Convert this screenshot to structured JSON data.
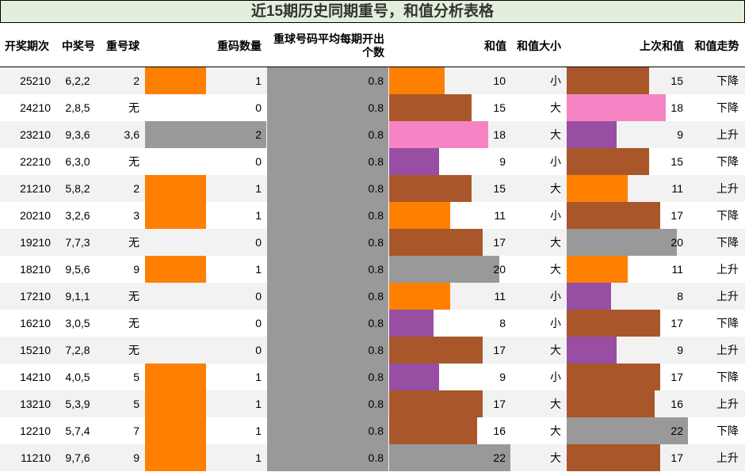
{
  "title": "近15期历史同期重号，和值分析表格",
  "headers": {
    "period": "开奖期次",
    "numbers": "中奖号",
    "repeat_ball": "重号球",
    "repeat_count": "重码数量",
    "avg_repeat": "重球号码平均每期开出个数",
    "sum": "和值",
    "sum_size": "和值大小",
    "prev_sum": "上次和值",
    "trend": "和值走势"
  },
  "colors": {
    "orange": "#ff7f00",
    "brown": "#a9572a",
    "pink": "#f683c3",
    "purple": "#984ea3",
    "gray": "#999999",
    "title_bg": "#e2efda",
    "row_shade": "#f2f2f2"
  },
  "chart_data": {
    "type": "table",
    "columns": [
      "开奖期次",
      "中奖号",
      "重号球",
      "重码数量",
      "重球号码平均每期开出个数",
      "和值",
      "和值大小",
      "上次和值",
      "和值走势"
    ],
    "rows": [
      {
        "period": "25210",
        "numbers": "6,2,2",
        "repeat_ball": "2",
        "repeat_count": 1,
        "avg_repeat": "0.8",
        "sum": 10,
        "size": "小",
        "prev_sum": 15,
        "trend": "下降"
      },
      {
        "period": "24210",
        "numbers": "2,8,5",
        "repeat_ball": "无",
        "repeat_count": 0,
        "avg_repeat": "0.8",
        "sum": 15,
        "size": "大",
        "prev_sum": 18,
        "trend": "下降"
      },
      {
        "period": "23210",
        "numbers": "9,3,6",
        "repeat_ball": "3,6",
        "repeat_count": 2,
        "avg_repeat": "0.8",
        "sum": 18,
        "size": "大",
        "prev_sum": 9,
        "trend": "上升"
      },
      {
        "period": "22210",
        "numbers": "6,3,0",
        "repeat_ball": "无",
        "repeat_count": 0,
        "avg_repeat": "0.8",
        "sum": 9,
        "size": "小",
        "prev_sum": 15,
        "trend": "下降"
      },
      {
        "period": "21210",
        "numbers": "5,8,2",
        "repeat_ball": "2",
        "repeat_count": 1,
        "avg_repeat": "0.8",
        "sum": 15,
        "size": "大",
        "prev_sum": 11,
        "trend": "上升"
      },
      {
        "period": "20210",
        "numbers": "3,2,6",
        "repeat_ball": "3",
        "repeat_count": 1,
        "avg_repeat": "0.8",
        "sum": 11,
        "size": "小",
        "prev_sum": 17,
        "trend": "下降"
      },
      {
        "period": "19210",
        "numbers": "7,7,3",
        "repeat_ball": "无",
        "repeat_count": 0,
        "avg_repeat": "0.8",
        "sum": 17,
        "size": "大",
        "prev_sum": 20,
        "trend": "下降"
      },
      {
        "period": "18210",
        "numbers": "9,5,6",
        "repeat_ball": "9",
        "repeat_count": 1,
        "avg_repeat": "0.8",
        "sum": 20,
        "size": "大",
        "prev_sum": 11,
        "trend": "上升"
      },
      {
        "period": "17210",
        "numbers": "9,1,1",
        "repeat_ball": "无",
        "repeat_count": 0,
        "avg_repeat": "0.8",
        "sum": 11,
        "size": "小",
        "prev_sum": 8,
        "trend": "上升"
      },
      {
        "period": "16210",
        "numbers": "3,0,5",
        "repeat_ball": "无",
        "repeat_count": 0,
        "avg_repeat": "0.8",
        "sum": 8,
        "size": "小",
        "prev_sum": 17,
        "trend": "下降"
      },
      {
        "period": "15210",
        "numbers": "7,2,8",
        "repeat_ball": "无",
        "repeat_count": 0,
        "avg_repeat": "0.8",
        "sum": 17,
        "size": "大",
        "prev_sum": 9,
        "trend": "上升"
      },
      {
        "period": "14210",
        "numbers": "4,0,5",
        "repeat_ball": "5",
        "repeat_count": 1,
        "avg_repeat": "0.8",
        "sum": 9,
        "size": "小",
        "prev_sum": 17,
        "trend": "下降"
      },
      {
        "period": "13210",
        "numbers": "5,3,9",
        "repeat_ball": "5",
        "repeat_count": 1,
        "avg_repeat": "0.8",
        "sum": 17,
        "size": "大",
        "prev_sum": 16,
        "trend": "上升"
      },
      {
        "period": "12210",
        "numbers": "5,7,4",
        "repeat_ball": "7",
        "repeat_count": 1,
        "avg_repeat": "0.8",
        "sum": 16,
        "size": "大",
        "prev_sum": 22,
        "trend": "下降"
      },
      {
        "period": "11210",
        "numbers": "9,7,6",
        "repeat_ball": "9",
        "repeat_count": 1,
        "avg_repeat": "0.8",
        "sum": 22,
        "size": "大",
        "prev_sum": 17,
        "trend": "上升"
      }
    ],
    "data_bars": {
      "repeat_count_max": 2,
      "avg_repeat_max": 0.8,
      "sum_max": 22,
      "color_by_value": {
        "repeat_count": {
          "1": "orange",
          "2": "gray"
        },
        "sum": {
          "8": "purple",
          "9": "purple",
          "10": "orange",
          "11": "orange",
          "15": "brown",
          "16": "brown",
          "17": "brown",
          "18": "pink",
          "20": "gray",
          "22": "gray"
        }
      }
    }
  }
}
